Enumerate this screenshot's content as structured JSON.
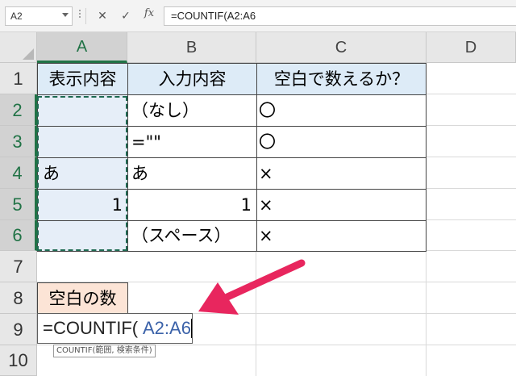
{
  "formula_bar": {
    "name_box": "A2",
    "cancel_icon": "✕",
    "enter_icon": "✓",
    "fx_label": "fx",
    "formula": "=COUNTIF(A2:A6"
  },
  "columns": [
    "A",
    "B",
    "C",
    "D"
  ],
  "rows": [
    "1",
    "2",
    "3",
    "4",
    "5",
    "6",
    "7",
    "8",
    "9",
    "10"
  ],
  "table": {
    "headers": [
      "表示内容",
      "入力内容",
      "空白で数えるか？"
    ],
    "rows": [
      [
        "",
        "（なし）",
        "〇"
      ],
      [
        "",
        "=\"\"",
        "〇"
      ],
      [
        "あ",
        "あ",
        "×"
      ],
      [
        "1",
        "1",
        "×"
      ],
      [
        "",
        "（スペース）",
        "×"
      ]
    ]
  },
  "blank_count_label": "空白の数",
  "editing_cell": {
    "equals": "=",
    "function": "COUNTIF(",
    "reference": "A2:A6"
  },
  "tooltip": "COUNTIF(範囲, 検索条件)",
  "colors": {
    "header_fill": "#ddebf7",
    "label_fill": "#fce4d6",
    "selection_fill": "#e6eef8",
    "marquee": "#1e6a52",
    "arrow": "#e8265e",
    "reference_text": "#3b62a9",
    "active_header_accent": "#217346"
  },
  "icons": [
    "chevron-down-icon",
    "cancel-icon",
    "check-icon",
    "fx-icon",
    "select-all-icon",
    "callout-arrow-icon"
  ]
}
